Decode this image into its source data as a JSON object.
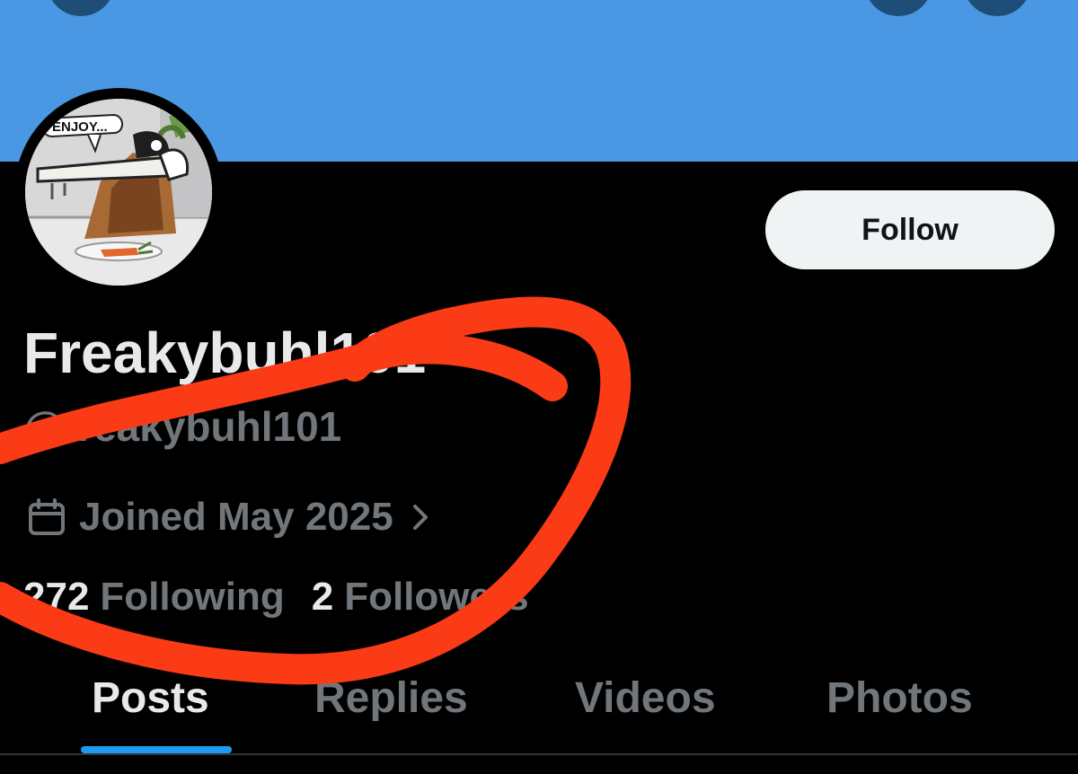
{
  "profile": {
    "display_name": "Freakybuhl101",
    "handle": "@freakybuhl101",
    "joined": "Joined May 2025",
    "following_count": "272",
    "following_label": "Following",
    "followers_count": "2",
    "followers_label": "Followers",
    "avatar_caption": "ENJOY..."
  },
  "actions": {
    "follow_label": "Follow"
  },
  "tabs": [
    {
      "label": "Posts",
      "active": true
    },
    {
      "label": "Replies",
      "active": false
    },
    {
      "label": "Videos",
      "active": false
    },
    {
      "label": "Photos",
      "active": false
    }
  ],
  "icons": {
    "joined": "calendar-icon",
    "joined_more": "chevron-right-icon"
  },
  "colors": {
    "banner": "#4a98e3",
    "accent": "#1d9bf0",
    "background": "#000000",
    "primary_text": "#e7e9ea",
    "secondary_text": "#71767b",
    "follow_button_bg": "#eff3f4",
    "annotation": "#fb3b16"
  }
}
